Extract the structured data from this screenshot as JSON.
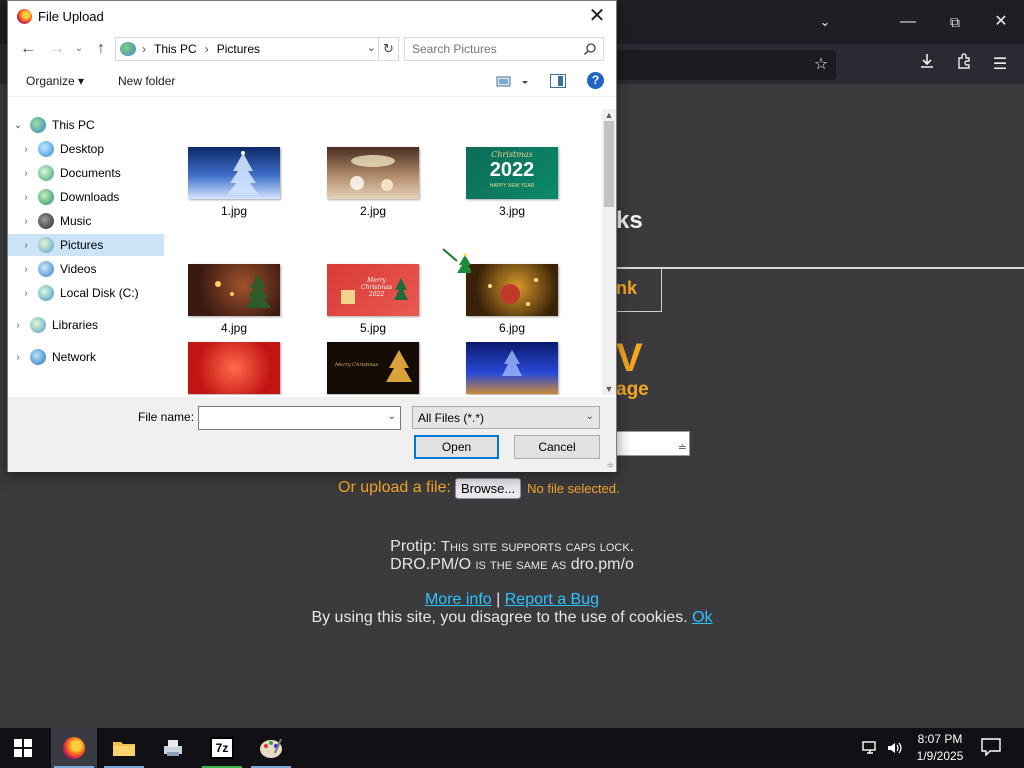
{
  "dialog": {
    "title": "File Upload",
    "address": {
      "crumbs": [
        "This PC",
        "Pictures"
      ]
    },
    "search_placeholder": "Search Pictures",
    "toolbar": {
      "organize": "Organize ▾",
      "new_folder": "New folder"
    },
    "nav": [
      {
        "label": "This PC",
        "expanded": true,
        "level": 0
      },
      {
        "label": "Desktop",
        "level": 1
      },
      {
        "label": "Documents",
        "level": 1
      },
      {
        "label": "Downloads",
        "level": 1
      },
      {
        "label": "Music",
        "level": 1
      },
      {
        "label": "Pictures",
        "level": 1,
        "selected": true
      },
      {
        "label": "Videos",
        "level": 1
      },
      {
        "label": "Local Disk (C:)",
        "level": 1
      },
      {
        "label": "Libraries",
        "level": 0
      },
      {
        "label": "Network",
        "level": 0
      }
    ],
    "files": [
      {
        "name": "1.jpg"
      },
      {
        "name": "2.jpg"
      },
      {
        "name": "3.jpg"
      },
      {
        "name": "4.jpg"
      },
      {
        "name": "5.jpg"
      },
      {
        "name": "6.jpg"
      },
      {
        "name": ""
      },
      {
        "name": ""
      },
      {
        "name": ""
      }
    ],
    "thumb_texts": {
      "t3_line1": "Christmas",
      "t3_year": "2022",
      "t3_line2": "HAPPY NEW YEAR",
      "t5_line1": "Merry",
      "t5_line2": "Christmas",
      "t5_year": "2022",
      "t8": "Merry Christmas"
    },
    "file_name_label": "File name:",
    "file_name_value": "",
    "filter": "All Files (*.*)",
    "open_label": "Open",
    "cancel_label": "Cancel"
  },
  "page": {
    "partial_heading": "ks",
    "partial_link": "nk",
    "partial_big": "V",
    "partial_sub": "age",
    "upload_label": "Or upload a file:",
    "browse_label": "Browse...",
    "no_file": "No file selected.",
    "protip_prefix": "Protip:",
    "protip_text": "This site supports caps lock.",
    "protip2_url": "DRO.PM/O",
    "protip2_text": "is the same as",
    "protip2_url_lower": "dro.pm/o",
    "more_info": "More info",
    "separator": "|",
    "report_bug": "Report a Bug",
    "cookie_text": "By using this site, you disagree to the use of cookies.",
    "ok_label": "Ok"
  },
  "taskbar": {
    "time": "8:07 PM",
    "date": "1/9/2025"
  }
}
